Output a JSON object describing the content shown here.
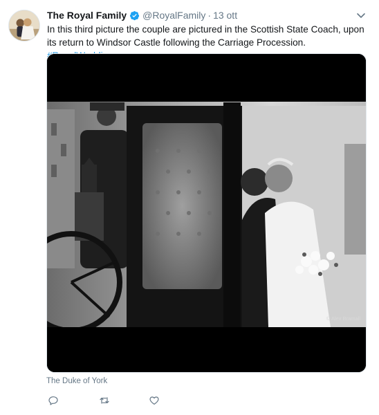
{
  "tweet": {
    "display_name": "The Royal Family",
    "handle": "@RoyalFamily",
    "separator": "·",
    "timestamp": "13 ott",
    "text_main": "In this third picture the couple are pictured in the Scottish State Coach, upon its return to Windsor Castle following the Carriage Procession.",
    "hashtag": "#RoyalWedding",
    "photo_credit": "© Alex Bramall",
    "tagged_user": "The Duke of York"
  },
  "icons": {
    "verified": "verified-badge-icon",
    "caret": "chevron-down-icon",
    "reply": "reply-icon",
    "retweet": "retweet-icon",
    "like": "heart-icon"
  },
  "colors": {
    "link": "#1b95e0",
    "secondary_text": "#657786",
    "verified": "#1da1f2"
  }
}
